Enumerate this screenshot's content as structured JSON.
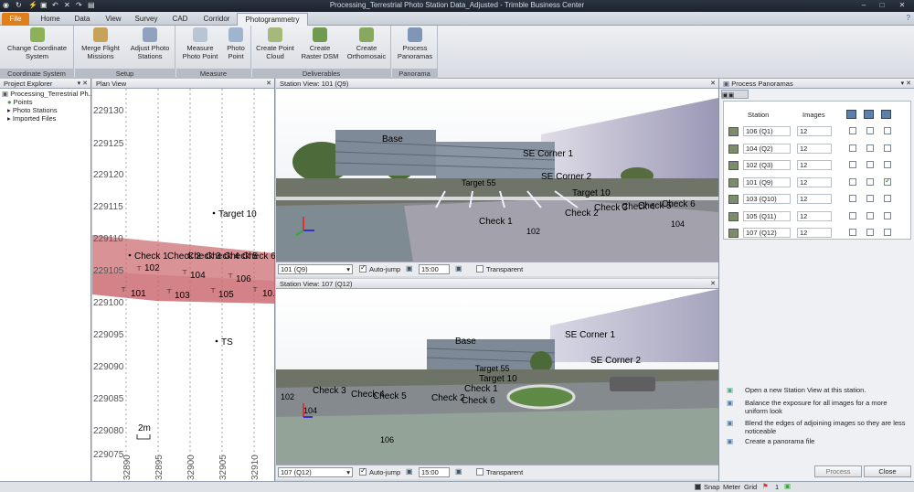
{
  "window": {
    "title": "Processing_Terrestrial Photo Station Data_Adjusted - Trimble Business Center"
  },
  "tabs": [
    "File",
    "Home",
    "Data",
    "View",
    "Survey",
    "CAD",
    "Corridor",
    "Photogrammetry"
  ],
  "ribbon": {
    "groups": [
      {
        "name": "Coordinate System",
        "buttons": [
          "Change Coordinate\nSystem"
        ]
      },
      {
        "name": "Setup",
        "buttons": [
          "Merge Flight\nMissions",
          "Adjust Photo\nStations"
        ]
      },
      {
        "name": "Measure",
        "buttons": [
          "Measure\nPhoto Point",
          "Photo\nPoint"
        ]
      },
      {
        "name": "Deliverables",
        "buttons": [
          "Create Point\nCloud",
          "Create\nRaster DSM",
          "Create\nOrthomosaic"
        ]
      },
      {
        "name": "Panorama",
        "buttons": [
          "Process\nPanoramas"
        ]
      }
    ]
  },
  "explorer": {
    "title": "Project Explorer",
    "items": [
      "Processing_Terrestrial Ph...",
      "Points",
      "Photo Stations",
      "Imported Files"
    ]
  },
  "plan_view": {
    "title": "Plan View",
    "y_ticks": [
      "229130",
      "229125",
      "229120",
      "229115",
      "229110",
      "229105",
      "229100",
      "229095",
      "229090",
      "229085",
      "229080",
      "229075"
    ],
    "x_ticks": [
      "32890",
      "32895",
      "32900",
      "32905",
      "32910"
    ],
    "points": [
      {
        "label": "Target 10"
      },
      {
        "label": "Check 1"
      },
      {
        "label": "Check 2"
      },
      {
        "label": "Check 3"
      },
      {
        "label": "Check 4"
      },
      {
        "label": "Check 5"
      },
      {
        "label": "Check 6"
      },
      {
        "label": "102"
      },
      {
        "label": "104"
      },
      {
        "label": "106"
      },
      {
        "label": "101"
      },
      {
        "label": "103"
      },
      {
        "label": "105"
      },
      {
        "label": "10."
      },
      {
        "label": "TS"
      }
    ],
    "scale": "2m"
  },
  "station_view_1": {
    "title": "Station View: 101 (Q9)",
    "labels": [
      "Base",
      "SE Corner 1",
      "SE Corner 2",
      "Target 55",
      "Target 10",
      "Check 1",
      "Check 2",
      "Check 3",
      "Check 4",
      "Check 5",
      "Check 6",
      "102",
      "104"
    ],
    "station_select": "101 (Q9)",
    "auto_jump": "Auto-jump",
    "time_value": "15:00",
    "transparent": "Transparent"
  },
  "station_view_2": {
    "title": "Station View: 107 (Q12)",
    "labels": [
      "Base",
      "SE Corner 1",
      "SE Corner 2",
      "Target 55",
      "Target 10",
      "Check 1",
      "Check 2",
      "Check 3",
      "Check 4",
      "Check 5",
      "Check 6",
      "102",
      "104",
      "106"
    ],
    "station_select": "107 (Q12)",
    "auto_jump": "Auto-jump",
    "time_value": "15:00",
    "transparent": "Transparent"
  },
  "process_panoramas": {
    "title": "Process Panoramas",
    "col_station": "Station",
    "col_images": "Images",
    "rows": [
      {
        "station": "106 (Q1)",
        "images": "12",
        "checked": false
      },
      {
        "station": "104 (Q2)",
        "images": "12",
        "checked": false
      },
      {
        "station": "102 (Q3)",
        "images": "12",
        "checked": false
      },
      {
        "station": "101 (Q9)",
        "images": "12",
        "checked": true
      },
      {
        "station": "103 (Q10)",
        "images": "12",
        "checked": false
      },
      {
        "station": "105 (Q11)",
        "images": "12",
        "checked": false
      },
      {
        "station": "107 (Q12)",
        "images": "12",
        "checked": false
      }
    ],
    "help": [
      "Open a new Station View at this station.",
      "Balance the exposure for all images for a more uniform look",
      "Blend the edges of adjoining images so they are less noticeable",
      "Create a panorama file"
    ],
    "process_btn": "Process",
    "close_btn": "Close"
  },
  "status": {
    "snap": "Snap",
    "meter": "Meter",
    "grid": "Grid",
    "count": "1"
  },
  "colors": {
    "file_tab": "#e07f1a",
    "titlebar": "#232a36",
    "plan_polygon": "#c9656b"
  }
}
